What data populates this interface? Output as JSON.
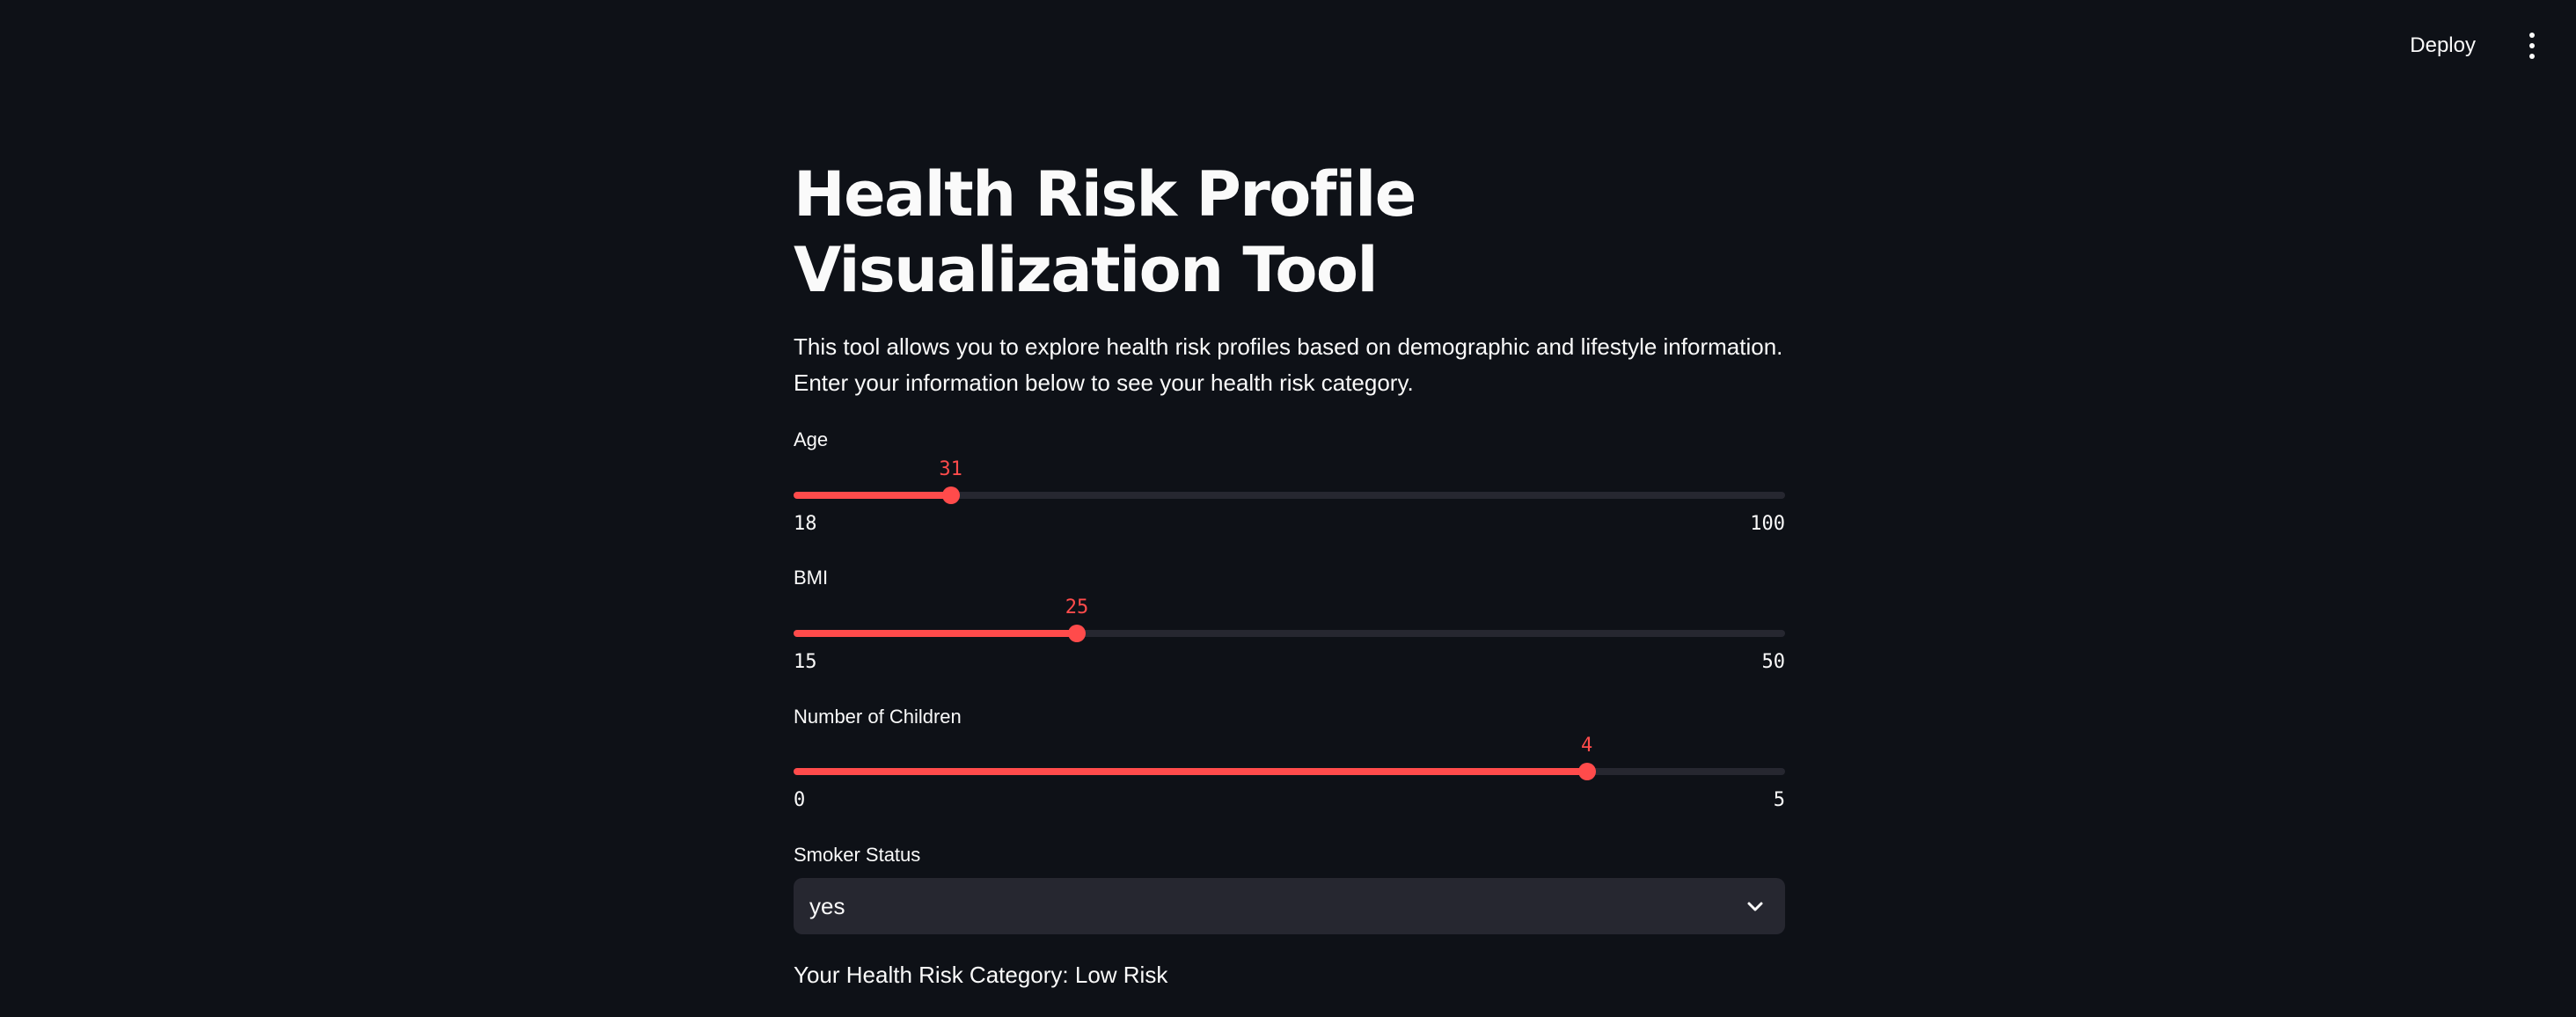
{
  "header": {
    "deploy_label": "Deploy",
    "menu_icon": "more-vertical-icon"
  },
  "main": {
    "title": "Health Risk Profile Visualization Tool",
    "description": "This tool allows you to explore health risk profiles based on demographic and lifestyle information. Enter your information below to see your health risk category."
  },
  "sliders": [
    {
      "label": "Age",
      "value": 31,
      "min": 18,
      "max": 100
    },
    {
      "label": "BMI",
      "value": 25,
      "min": 15,
      "max": 50
    },
    {
      "label": "Number of Children",
      "value": 4,
      "min": 0,
      "max": 5
    }
  ],
  "smoker": {
    "label": "Smoker Status",
    "value": "yes",
    "icon": "chevron-down-icon"
  },
  "result": {
    "text": "Your Health Risk Category: Low Risk"
  },
  "colors": {
    "background": "#0e1117",
    "accent": "#ff4b4b",
    "track": "#262730",
    "text": "#fafafa"
  }
}
